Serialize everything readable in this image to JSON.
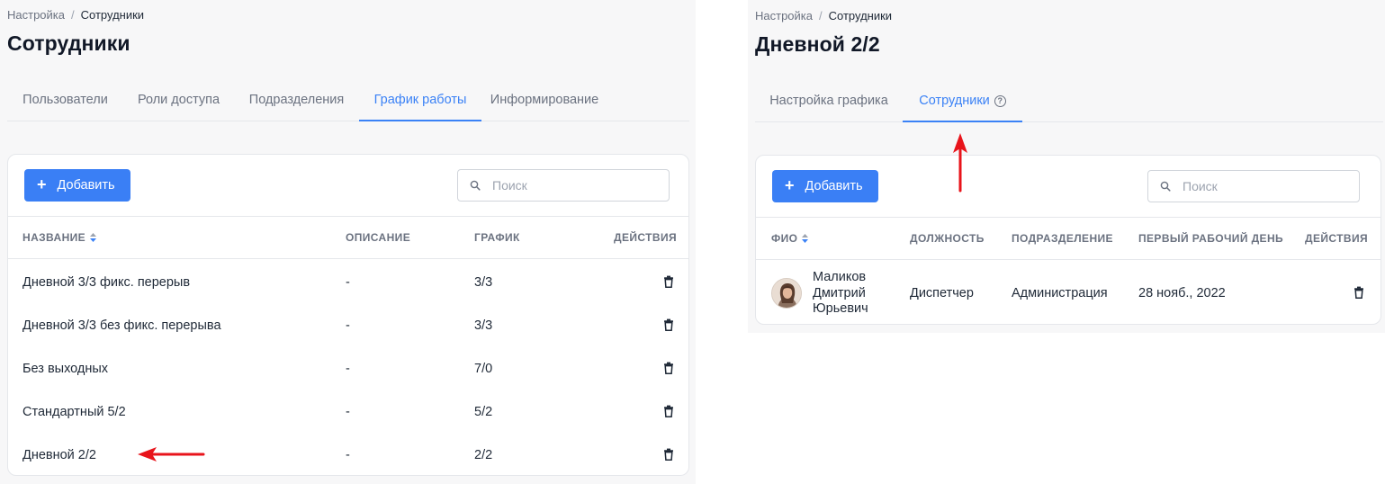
{
  "left": {
    "breadcrumb": {
      "root": "Настройка",
      "separator": "/",
      "current": "Сотрудники"
    },
    "title": "Сотрудники",
    "tabs": [
      {
        "label": "Пользователи",
        "active": false
      },
      {
        "label": "Роли доступа",
        "active": false
      },
      {
        "label": "Подразделения",
        "active": false
      },
      {
        "label": "График работы",
        "active": true
      },
      {
        "label": "Информирование",
        "active": false
      }
    ],
    "add_button_label": "Добавить",
    "search": {
      "placeholder": "Поиск",
      "value": ""
    },
    "columns": {
      "name": "НАЗВАНИЕ",
      "description": "ОПИСАНИЕ",
      "schedule": "ГРАФИК",
      "actions": "ДЕЙСТВИЯ"
    },
    "rows": [
      {
        "name": "Дневной 3/3 фикс. перерыв",
        "description": "-",
        "schedule": "3/3"
      },
      {
        "name": "Дневной 3/3 без фикс. перерыва",
        "description": "-",
        "schedule": "3/3"
      },
      {
        "name": "Без выходных",
        "description": "-",
        "schedule": "7/0"
      },
      {
        "name": "Стандартный 5/2",
        "description": "-",
        "schedule": "5/2"
      },
      {
        "name": "Дневной 2/2",
        "description": "-",
        "schedule": "2/2"
      }
    ]
  },
  "right": {
    "breadcrumb": {
      "root": "Настройка",
      "separator": "/",
      "current": "Сотрудники"
    },
    "title": "Дневной 2/2",
    "tabs": [
      {
        "label": "Настройка графика",
        "active": false
      },
      {
        "label": "Сотрудники",
        "active": true
      }
    ],
    "add_button_label": "Добавить",
    "search": {
      "placeholder": "Поиск",
      "value": ""
    },
    "columns": {
      "fio": "ФИО",
      "position": "ДОЛЖНОСТЬ",
      "department": "ПОДРАЗДЕЛЕНИЕ",
      "first_day": "ПЕРВЫЙ РАБОЧИЙ ДЕНЬ",
      "actions": "ДЕЙСТВИЯ"
    },
    "employee": {
      "name_line1": "Маликов",
      "name_line2": "Дмитрий",
      "name_line3": "Юрьевич",
      "position": "Диспетчер",
      "department": "Администрация",
      "first_day": "28 нояб., 2022"
    }
  },
  "icons": {
    "plus": "plus-icon",
    "search": "search-icon",
    "sort": "sort-icon",
    "trash": "trash-icon",
    "help": "help-icon",
    "annotation": "red-arrow"
  },
  "colors": {
    "accent": "#3b82f6",
    "button": "#3a7ff5",
    "annotation": "#e8141b",
    "panel_bg": "#f7f7f8"
  }
}
